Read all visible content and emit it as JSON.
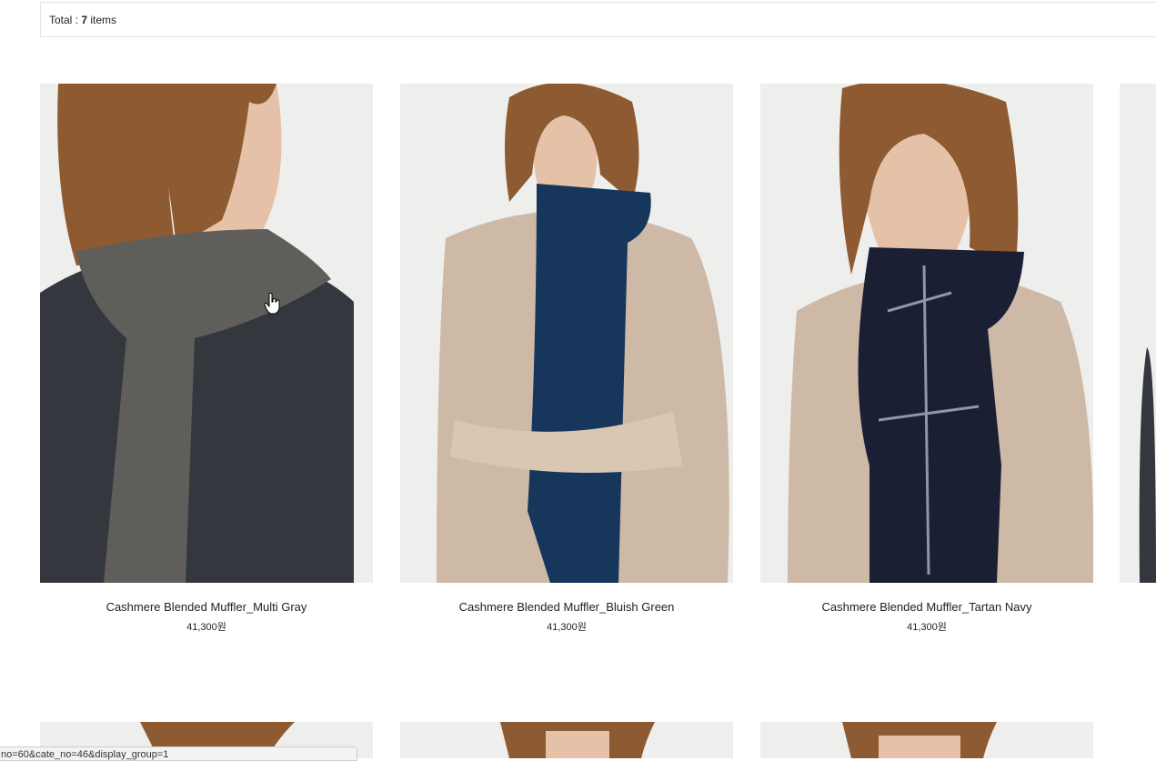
{
  "total": {
    "prefix": "Total : ",
    "count": "7",
    "suffix": " items"
  },
  "products": [
    {
      "name": "Cashmere Blended Muffler_Multi Gray",
      "price": "41,300원",
      "scarf_color": "#5f5e5a",
      "sweater_color": "#34373d"
    },
    {
      "name": "Cashmere Blended Muffler_Bluish Green",
      "price": "41,300원",
      "scarf_color": "#16365c",
      "sweater_color": "#cdb9a5"
    },
    {
      "name": "Cashmere Blended Muffler_Tartan Navy",
      "price": "41,300원",
      "scarf_color": "#1a1f33",
      "sweater_color": "#cdb9a5"
    }
  ],
  "status_url": "no=60&cate_no=46&display_group=1",
  "colors": {
    "background": "#ececeb",
    "hair": "#8e5a32",
    "skin": "#e5c2a7"
  }
}
